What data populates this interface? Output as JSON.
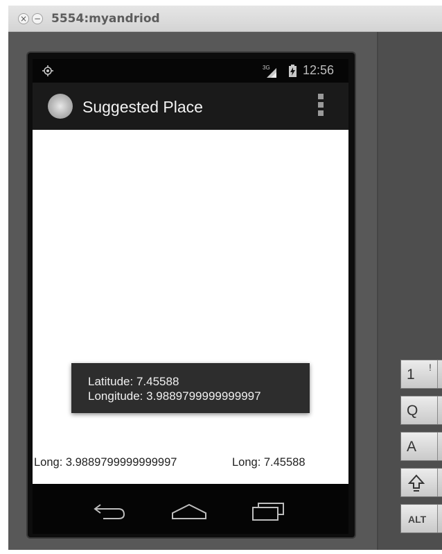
{
  "window": {
    "close_glyph": "×",
    "minimize_glyph": "−",
    "title": "5554:myandriod"
  },
  "statusbar": {
    "signal_label": "3G",
    "time": "12:56",
    "icons": [
      "gps-icon",
      "signal-icon",
      "battery-charging-icon"
    ]
  },
  "actionbar": {
    "title": "Suggested Place",
    "icons": [
      "app-icon",
      "overflow-menu-icon"
    ]
  },
  "toast": {
    "latitude": "Latitude: 7.45588",
    "longitude": "Longitude: 3.9889799999999997"
  },
  "content": {
    "left_label": "Long: 3.9889799999999997",
    "right_label": "Long: 7.45588"
  },
  "navbar": {
    "icons": [
      "back-icon",
      "home-icon",
      "recent-apps-icon"
    ]
  },
  "keyboard": {
    "keys": [
      {
        "main": "1",
        "alt": "!"
      },
      {
        "main": "Q",
        "alt": ""
      },
      {
        "main": "A",
        "alt": ""
      },
      {
        "main": "",
        "alt": "",
        "icon": "shift-icon"
      },
      {
        "main": "ALT",
        "alt": ""
      }
    ]
  },
  "colors": {
    "emulator_body": "#585858",
    "status_bar": "#060606",
    "action_bar": "#1a1a1a",
    "toast": "#2d2d2d",
    "content": "#ffffff"
  }
}
